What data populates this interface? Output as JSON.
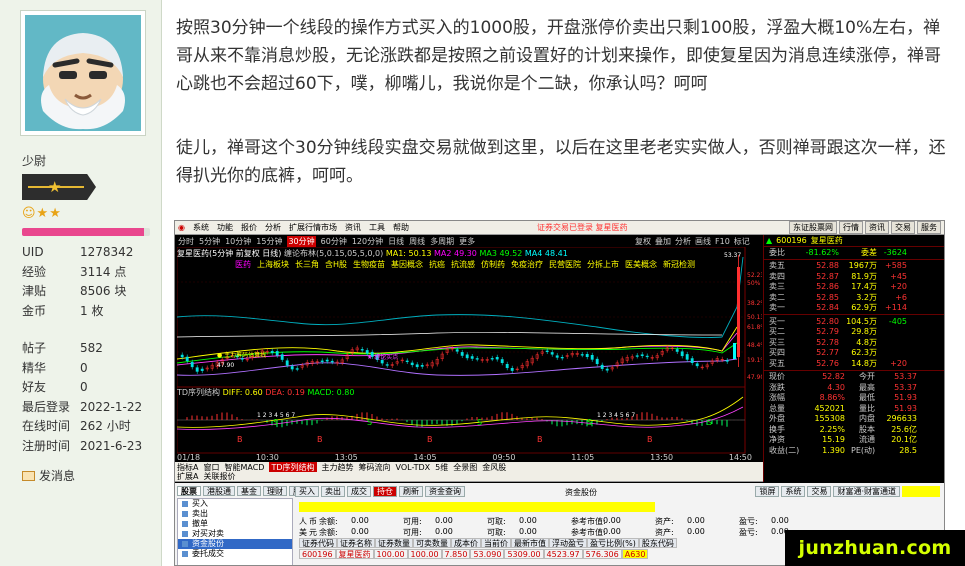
{
  "profile": {
    "rank": "少尉",
    "stars": "☺★★",
    "progress": 0.95,
    "stats_top": [
      {
        "k": "UID",
        "v": "1278342"
      },
      {
        "k": "经验",
        "v": "3114 点"
      },
      {
        "k": "津贴",
        "v": "8506 块"
      },
      {
        "k": "金币",
        "v": "1 枚"
      }
    ],
    "stats_bottom": [
      {
        "k": "帖子",
        "v": "582"
      },
      {
        "k": "精华",
        "v": "0"
      },
      {
        "k": "好友",
        "v": "0"
      },
      {
        "k": "最后登录",
        "v": "2022-1-22"
      },
      {
        "k": "在线时间",
        "v": "262 小时"
      },
      {
        "k": "注册时间",
        "v": "2021-6-23"
      }
    ],
    "message_link": "发消息"
  },
  "post": {
    "paragraphs": [
      "按照30分钟一个线段的操作方式买入的1000股，开盘涨停价卖出只剩100股，浮盈大概10%左右，禅哥从来不靠消息炒股，无论涨跌都是按照之前设置好的计划来操作，即使复星因为消息连续涨停，禅哥心跳也不会超过60下，噗，柳嘴儿，我说你是个二缺，你承认吗？呵呵",
      "徒儿，禅哥这个30分钟线段实盘交易就做到这里，以后在这里老老实实做人，否则禅哥跟这次一样，还得扒光你的底裤，呵呵。"
    ]
  },
  "software": {
    "menu": [
      "系统",
      "功能",
      "报价",
      "分析",
      "扩展行情市场",
      "资讯",
      "工具",
      "帮助"
    ],
    "menu_status": "证券交易已登录  复星医药",
    "menu_right": [
      "东证股票网",
      "行情",
      "资讯",
      "交易",
      "服务"
    ],
    "periods": [
      "分时",
      "5分钟",
      "10分钟",
      "15分钟",
      "30分钟",
      "60分钟",
      "120分钟",
      "日线",
      "周线",
      "多周期",
      "更多"
    ],
    "periods_active": "30分钟",
    "toolbar2": [
      "复权",
      "叠加",
      "分析",
      "画线",
      "F10",
      "标记"
    ],
    "ma_line": {
      "title": "复星医药(5分钟 前复权 日线)",
      "segments": [
        {
          "t": " 缠论布林(5,0.15,05,5,0,0) ",
          "c": ""
        },
        {
          "t": "MA1: 50.13 ",
          "c": "y"
        },
        {
          "t": "MA2 49.30 ",
          "c": "p"
        },
        {
          "t": "MA3 49.52 ",
          "c": "g"
        },
        {
          "t": "MA4 48.41 ",
          "c": "c"
        }
      ]
    },
    "concepts": [
      "医药",
      "上海板块",
      "长三角",
      "含H股",
      "生物疫苗",
      "基因概念",
      "抗癌",
      "抗流感",
      "仿制药",
      "免疫治疗",
      "民营医院",
      "分拆上市",
      "医美概念",
      "新冠检测"
    ],
    "td_label": {
      "segments": [
        {
          "t": "TD序列结构 ",
          "c": ""
        },
        {
          "t": "DIFF: 0.60 ",
          "c": "y"
        },
        {
          "t": "DEA: 0.19 ",
          "c": "r"
        },
        {
          "t": "MACD: 0.80 ",
          "c": "g"
        }
      ]
    },
    "time_axis": [
      "01/18",
      "10:30",
      "13:05",
      "14:05",
      "09:50",
      "11:05",
      "13:50",
      "14:50"
    ],
    "tabs_row1": [
      "指标A",
      "窗口",
      "智能MACD",
      "TD序列结构",
      "主力趋势",
      "筹码流向",
      "VOL-TDX",
      "5维",
      "全景图",
      "金风股"
    ],
    "tabs_row1_active": "TD序列结构",
    "tabs_row2": [
      "扩展A",
      "关联报价"
    ],
    "quote": {
      "code": "600196",
      "name": "复星医药",
      "wei": [
        {
          "lbl": "委比",
          "v1": "-81.62%",
          "v2": "委差",
          "v3": "-3624",
          "c1": "green",
          "c3": "green"
        }
      ],
      "sell": [
        {
          "lbl": "卖五",
          "v1": "52.88",
          "v2": "1967万",
          "v3": "+585"
        },
        {
          "lbl": "卖四",
          "v1": "52.87",
          "v2": "81.9万",
          "v3": "+45"
        },
        {
          "lbl": "卖三",
          "v1": "52.86",
          "v2": "17.4万",
          "v3": "+20"
        },
        {
          "lbl": "卖二",
          "v1": "52.85",
          "v2": "3.2万",
          "v3": "+6"
        },
        {
          "lbl": "卖一",
          "v1": "52.84",
          "v2": "62.9万",
          "v3": "+114"
        }
      ],
      "buy": [
        {
          "lbl": "买一",
          "v1": "52.80",
          "v2": "104.5万",
          "v3": "-405"
        },
        {
          "lbl": "买二",
          "v1": "52.79",
          "v2": "29.8万",
          "v3": ""
        },
        {
          "lbl": "买三",
          "v1": "52.78",
          "v2": "4.8万",
          "v3": ""
        },
        {
          "lbl": "买四",
          "v1": "52.77",
          "v2": "62.3万",
          "v3": ""
        },
        {
          "lbl": "买五",
          "v1": "52.76",
          "v2": "14.8万",
          "v3": "+20"
        }
      ],
      "info": [
        {
          "a": "现价",
          "b": "52.82",
          "c": "今开",
          "d": "53.37"
        },
        {
          "a": "涨跌",
          "b": "4.30",
          "c": "最高",
          "d": "53.37"
        },
        {
          "a": "涨幅",
          "b": "8.86%",
          "c": "最低",
          "d": "51.93"
        },
        {
          "a": "总量",
          "b": "452021",
          "c": "量比",
          "d": "51.93"
        },
        {
          "a": "外盘",
          "b": "155308",
          "c": "内盘",
          "d": "296633"
        },
        {
          "a": "换手",
          "b": "2.25%",
          "c": "股本",
          "d": "25.6亿"
        },
        {
          "a": "净资",
          "b": "15.19",
          "c": "流通",
          "d": "20.1亿"
        },
        {
          "a": "收益(二)",
          "b": "1.390",
          "c": "PE(动)",
          "d": "28.5"
        }
      ]
    },
    "trade": {
      "tabs": [
        "股票",
        "港股通",
        "基金",
        "理财",
        "服务"
      ],
      "tabs_active": "股票",
      "tree": [
        "买入",
        "卖出",
        "撤单",
        "对买对卖",
        "资金股份",
        "委托成交"
      ],
      "tree_selected": "资金股份",
      "buttons": [
        "买入",
        "卖出",
        "成交",
        "持仓",
        "刷新",
        "资金查询"
      ],
      "buttons_active": "持仓",
      "title": "资金股份",
      "right": [
        "锁屏",
        "系统",
        "交易",
        "财富通·财富通道"
      ],
      "acct_lines": [
        [
          "人",
          "币",
          "余额:",
          "0.00",
          "可用:",
          "0.00",
          "可取:",
          "0.00",
          "参考市值:",
          "0.00",
          "资产:",
          "0.00",
          "盈亏:",
          "0.00"
        ],
        [
          "美",
          "元",
          "余额:",
          "0.00",
          "可用:",
          "0.00",
          "可取:",
          "0.00",
          "参考市值:",
          "0.00",
          "资产:",
          "0.00",
          "盈亏:",
          "0.00"
        ]
      ],
      "grid_head": [
        "证券代码",
        "证券名称",
        "证券数量",
        "可卖数量",
        "成本价",
        "当前价",
        "最新市值",
        "浮动盈亏",
        "盈亏比例(%)",
        "股东代码"
      ],
      "grid_row": [
        "600196",
        "复星医药",
        "100.00",
        "100.00",
        "7.850",
        "53.090",
        "5309.00",
        "4523.97",
        "576.306",
        "A630"
      ]
    }
  },
  "watermark": "junzhuan.com"
}
